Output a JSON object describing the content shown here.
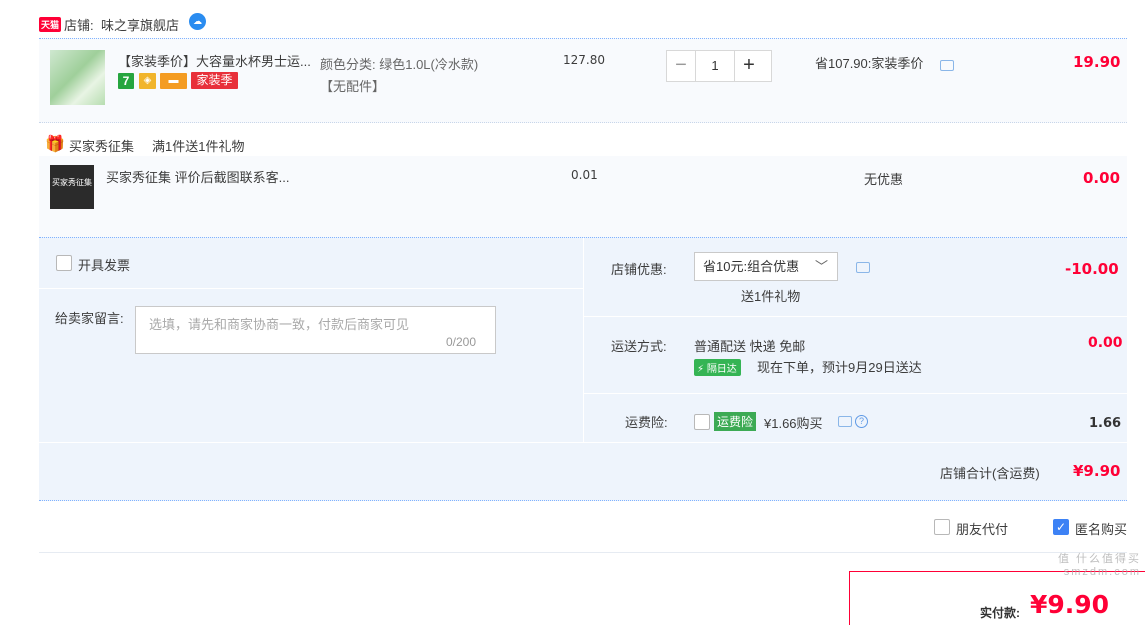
{
  "shop": {
    "platform_badge": "天猫",
    "label": "店铺:",
    "name": "味之享旗舰店"
  },
  "item": {
    "title": "【家装季价】大容量水杯男士运...",
    "spec": "颜色分类: 绿色1.0L(冷水款)",
    "accessory": "【无配件】",
    "unit_price": "127.80",
    "quantity": "1",
    "discount": "省107.90:家装季价",
    "subtotal": "19.90",
    "tags": [
      "7",
      "家装季"
    ]
  },
  "gift": {
    "label": "买家秀征集",
    "rule": "满1件送1件礼物",
    "item_title": "买家秀征集 评价后截图联系客...",
    "thumb_text": "买家秀征集",
    "unit_price": "0.01",
    "discount": "无优惠",
    "subtotal": "0.00"
  },
  "invoice": {
    "label": "开具发票"
  },
  "message": {
    "label": "给卖家留言:",
    "placeholder": "选填，请先和商家协商一致，付款后商家可见",
    "counter": "0/200"
  },
  "shop_discount": {
    "label": "店铺优惠:",
    "selected": "省10元:组合优惠",
    "note": "送1件礼物",
    "amount": "-10.00"
  },
  "shipping": {
    "label": "运送方式:",
    "method": "普通配送 快递 免邮",
    "badge": "隔日达",
    "estimate": "现在下单，预计9月29日送达",
    "amount": "0.00"
  },
  "insurance": {
    "label": "运费险:",
    "badge": "运费险",
    "text": "¥1.66购买",
    "amount": "1.66"
  },
  "shop_total": {
    "label": "店铺合计(含运费)",
    "amount": "¥9.90"
  },
  "options": {
    "friend_pay": "朋友代付",
    "anonymous": "匿名购买"
  },
  "payment": {
    "label": "实付款:",
    "amount": "¥9.90"
  },
  "watermark": "值 什么值得买 smzdm.com",
  "colors": {
    "accent_red": "#ff0036",
    "link_blue": "#3d82f5",
    "dotted_border": "#80b2ff"
  }
}
